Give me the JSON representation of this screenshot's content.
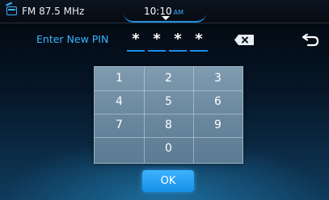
{
  "status": {
    "station": "FM 87.5 MHz",
    "time": "10:10",
    "ampm": "AM"
  },
  "pin": {
    "label": "Enter New PIN",
    "slots": [
      "*",
      "*",
      "*",
      "*"
    ]
  },
  "keypad": {
    "keys": [
      "1",
      "2",
      "3",
      "4",
      "5",
      "6",
      "7",
      "8",
      "9",
      "0"
    ]
  },
  "ok_label": "OK",
  "colors": {
    "accent": "#3ab0ff",
    "keypad_bg": "#6a889e",
    "ok_button": "#1f9af0"
  },
  "icons": {
    "radio": "radio-icon",
    "backspace": "backspace-icon",
    "back": "back-arrow-icon",
    "dropdown": "chevron-down-icon"
  }
}
